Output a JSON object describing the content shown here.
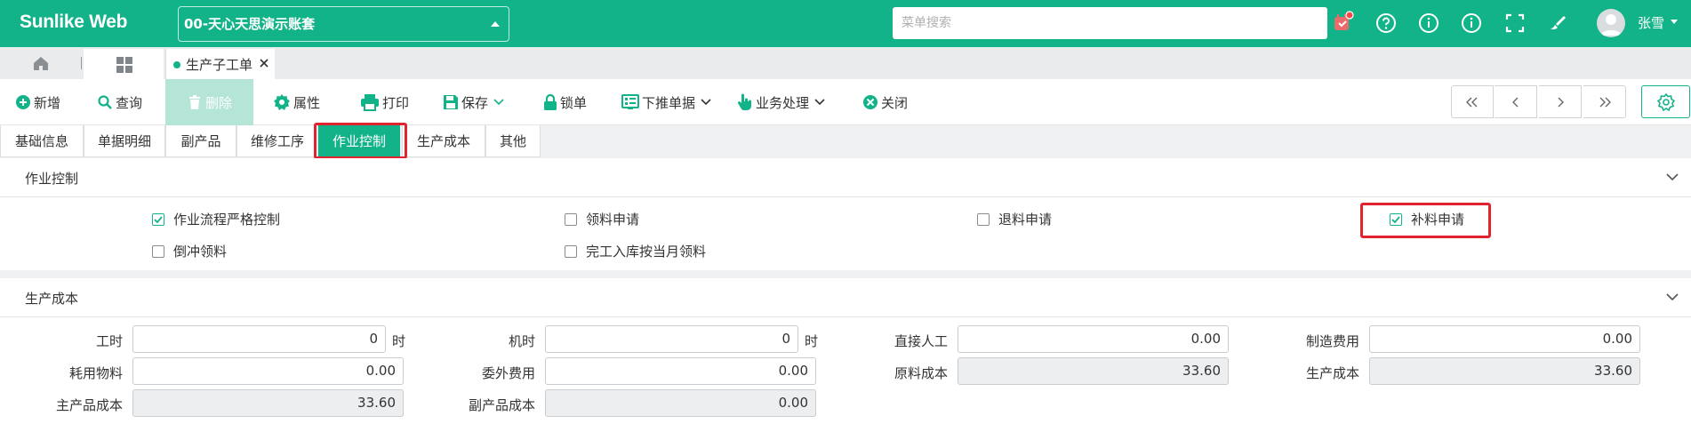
{
  "app": {
    "brand": "Sunlike Web",
    "account": "00-天心天思演示账套",
    "search_placeholder": "菜单搜索",
    "user": "张雪",
    "accent": "#13b38a",
    "highlight": "#e0242f"
  },
  "tabs": {
    "home_icon": "home-icon",
    "grid_icon": "grid-icon",
    "doc_tab": "生产子工单"
  },
  "toolbar": {
    "new": "新增",
    "query": "查询",
    "delete": "删除",
    "properties": "属性",
    "print": "打印",
    "save": "保存",
    "lock": "锁单",
    "push_down": "下推单据",
    "business": "业务处理",
    "close": "关闭"
  },
  "section_tabs": [
    "基础信息",
    "单据明细",
    "副产品",
    "维修工序",
    "作业控制",
    "生产成本",
    "其他"
  ],
  "work_control": {
    "title": "作业控制",
    "options": [
      {
        "label": "作业流程严格控制",
        "checked": true
      },
      {
        "label": "领料申请",
        "checked": false
      },
      {
        "label": "退料申请",
        "checked": false
      },
      {
        "label": "补料申请",
        "checked": true
      },
      {
        "label": "倒冲领料",
        "checked": false
      },
      {
        "label": "完工入库按当月领料",
        "checked": false
      }
    ]
  },
  "production_cost": {
    "title": "生产成本",
    "fields": [
      {
        "label": "工时",
        "value": "0",
        "unit": "时",
        "readonly": false
      },
      {
        "label": "机时",
        "value": "0",
        "unit": "时",
        "readonly": false
      },
      {
        "label": "直接人工",
        "value": "0.00",
        "readonly": false
      },
      {
        "label": "制造费用",
        "value": "0.00",
        "readonly": false
      },
      {
        "label": "耗用物料",
        "value": "0.00",
        "readonly": false
      },
      {
        "label": "委外费用",
        "value": "0.00",
        "readonly": false
      },
      {
        "label": "原料成本",
        "value": "33.60",
        "readonly": true
      },
      {
        "label": "生产成本",
        "value": "33.60",
        "readonly": true
      },
      {
        "label": "主产品成本",
        "value": "33.60",
        "readonly": true
      },
      {
        "label": "副产品成本",
        "value": "0.00",
        "readonly": true
      }
    ]
  }
}
